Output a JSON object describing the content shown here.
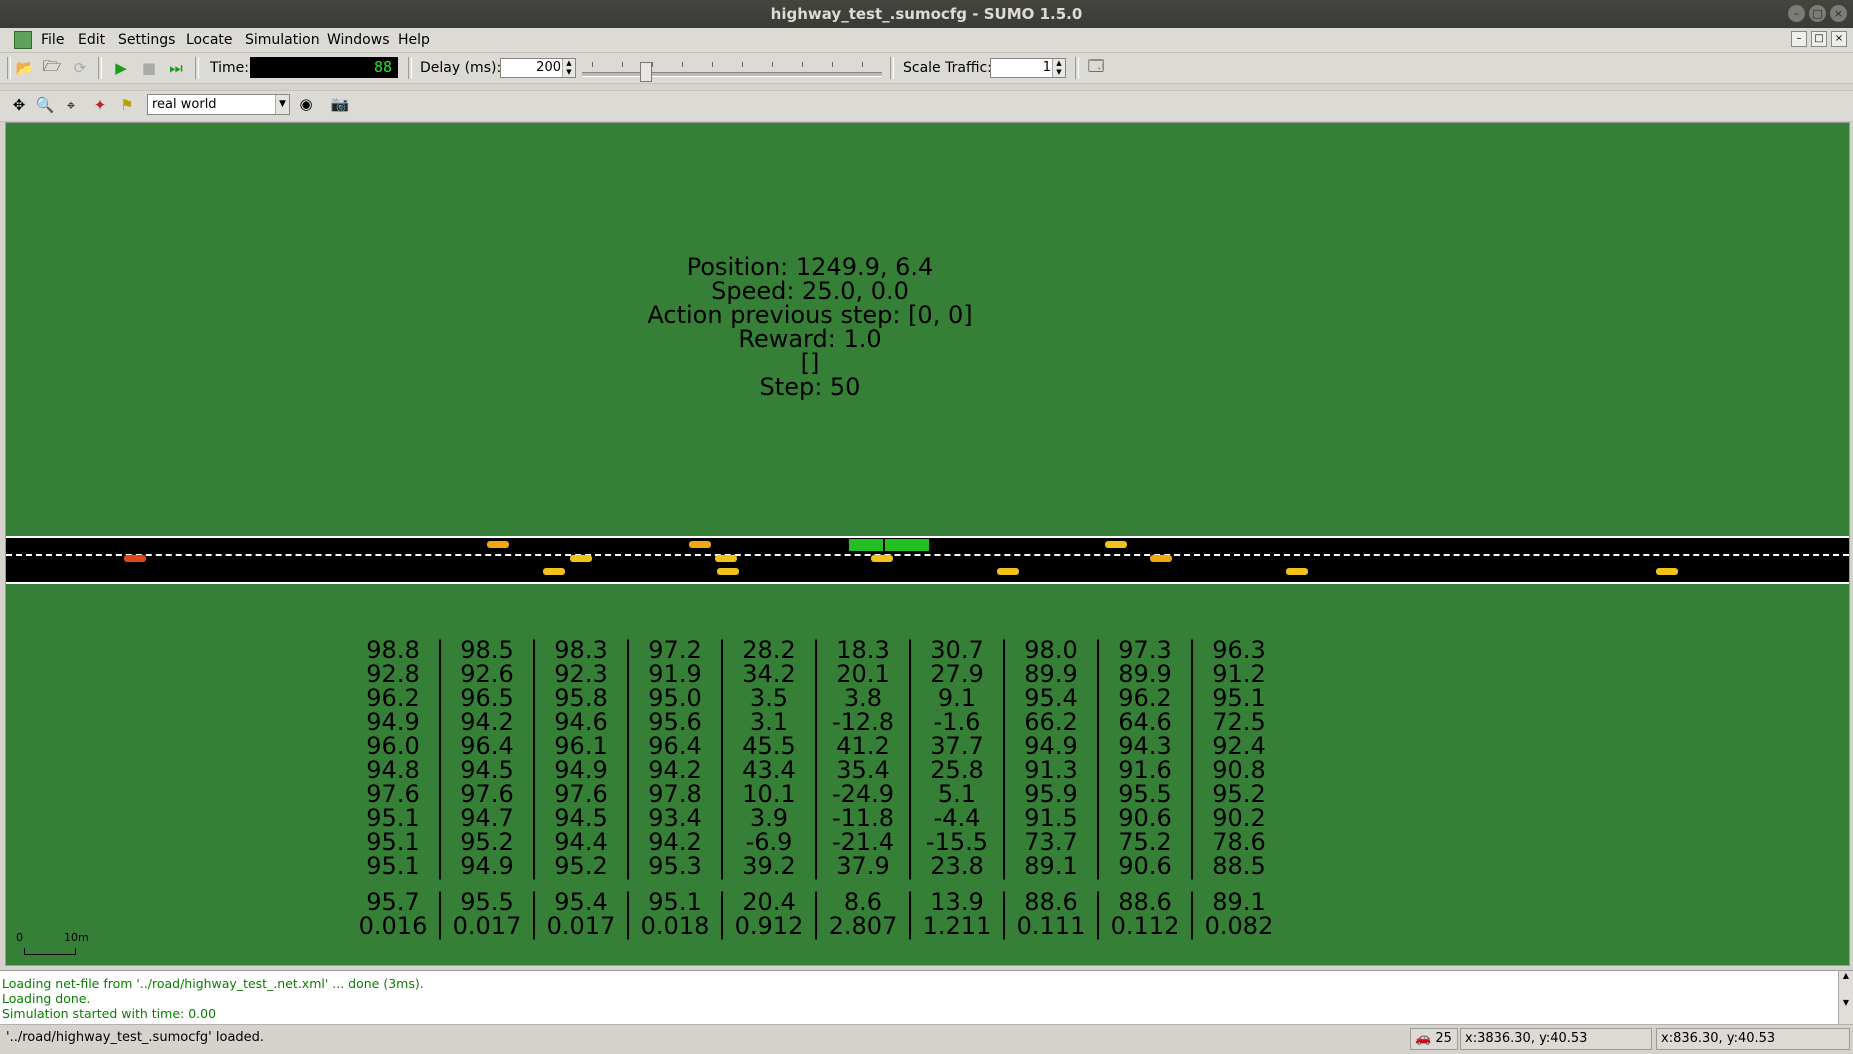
{
  "window": {
    "title": "highway_test_.sumocfg - SUMO 1.5.0",
    "buttons": [
      "–",
      "□",
      "×"
    ]
  },
  "menu": [
    "File",
    "Edit",
    "Settings",
    "Locate",
    "Simulation",
    "Windows",
    "Help"
  ],
  "toolbar": {
    "time_label": "Time:",
    "time_value": "88",
    "delay_label": "Delay (ms):",
    "delay_value": "200",
    "scale_label": "Scale Traffic:",
    "scale_value": "1"
  },
  "view_toolbar": {
    "scheme": "real world"
  },
  "info": {
    "position": "Position: 1249.9, 6.4",
    "speed": "Speed: 25.0, 0.0",
    "action": "Action previous step: [0, 0]",
    "reward": "Reward: 1.0",
    "bracket": "[]",
    "step": "Step: 50"
  },
  "table": {
    "rows": [
      [
        "98.8",
        "98.5",
        "98.3",
        "97.2",
        "28.2",
        "18.3",
        "30.7",
        "98.0",
        "97.3",
        "96.3"
      ],
      [
        "92.8",
        "92.6",
        "92.3",
        "91.9",
        "34.2",
        "20.1",
        "27.9",
        "89.9",
        "89.9",
        "91.2"
      ],
      [
        "96.2",
        "96.5",
        "95.8",
        "95.0",
        "3.5",
        "3.8",
        "9.1",
        "95.4",
        "96.2",
        "95.1"
      ],
      [
        "94.9",
        "94.2",
        "94.6",
        "95.6",
        "3.1",
        "-12.8",
        "-1.6",
        "66.2",
        "64.6",
        "72.5"
      ],
      [
        "96.0",
        "96.4",
        "96.1",
        "96.4",
        "45.5",
        "41.2",
        "37.7",
        "94.9",
        "94.3",
        "92.4"
      ],
      [
        "94.8",
        "94.5",
        "94.9",
        "94.2",
        "43.4",
        "35.4",
        "25.8",
        "91.3",
        "91.6",
        "90.8"
      ],
      [
        "97.6",
        "97.6",
        "97.6",
        "97.8",
        "10.1",
        "-24.9",
        "5.1",
        "95.9",
        "95.5",
        "95.2"
      ],
      [
        "95.1",
        "94.7",
        "94.5",
        "93.4",
        "3.9",
        "-11.8",
        "-4.4",
        "91.5",
        "90.6",
        "90.2"
      ],
      [
        "95.1",
        "95.2",
        "94.4",
        "94.2",
        "-6.9",
        "-21.4",
        "-15.5",
        "73.7",
        "75.2",
        "78.6"
      ],
      [
        "95.1",
        "94.9",
        "95.2",
        "95.3",
        "39.2",
        "37.9",
        "23.8",
        "89.1",
        "90.6",
        "88.5"
      ]
    ],
    "mean": [
      "95.7",
      "95.5",
      "95.4",
      "95.1",
      "20.4",
      "8.6",
      "13.9",
      "88.6",
      "88.6",
      "89.1"
    ],
    "std": [
      "0.016",
      "0.017",
      "0.017",
      "0.018",
      "0.912",
      "2.807",
      "1.211",
      "0.111",
      "0.112",
      "0.082"
    ]
  },
  "scale": {
    "zero": "0",
    "ten": "10m"
  },
  "log": [
    "Loading net-file from '../road/highway_test_.net.xml' ... done (3ms).",
    "Loading done.",
    "Simulation started with time: 0.00"
  ],
  "status": {
    "message": "'../road/highway_test_.sumocfg' loaded.",
    "vehicles": "25",
    "coord1": "x:3836.30, y:40.53",
    "coord2": "x:836.30, y:40.53"
  },
  "colors": {
    "background": "#367f36",
    "road": "#000000",
    "ego": "#23c023",
    "log_text": "#0a7d00"
  }
}
